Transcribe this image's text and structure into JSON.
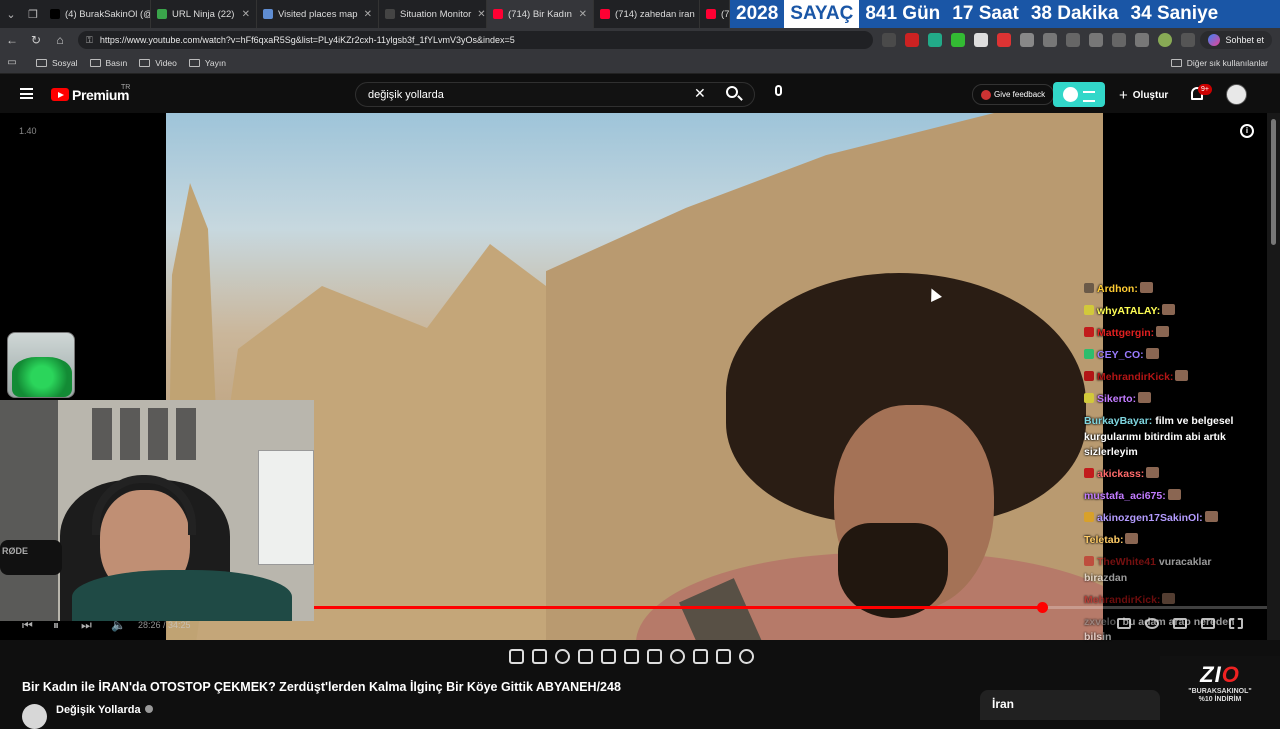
{
  "browser": {
    "tabs": [
      {
        "label": "(4) BurakSakinOl (@",
        "icon": "x-logo-icon",
        "color": "#000000",
        "active": false
      },
      {
        "label": "URL Ninja (22)",
        "icon": "ninja-icon",
        "color": "#3aa44b",
        "active": false
      },
      {
        "label": "Visited places map",
        "icon": "globe-icon",
        "color": "#5f8dd3",
        "active": false
      },
      {
        "label": "Situation Monitor",
        "icon": "monitor-icon",
        "color": "#444444",
        "active": false
      },
      {
        "label": "(714) Bir Kadın",
        "icon": "youtube-icon",
        "color": "#ff0033",
        "active": true
      },
      {
        "label": "(714) zahedan iran",
        "icon": "youtube-icon",
        "color": "#ff0033",
        "active": false
      },
      {
        "label": "(7",
        "icon": "youtube-icon",
        "color": "#ff0033",
        "active": false
      }
    ],
    "countdown": {
      "year": "2028",
      "label": "SAYAÇ",
      "days": "841 Gün",
      "hours": "17 Saat",
      "minutes": "38 Dakika",
      "seconds": "34 Saniye"
    },
    "url": "https://www.youtube.com/watch?v=hFf6qxaR5Sg&list=PLy4iKZr2cxh-11ylgsb3f_1fYLvmV3yOs&index=5",
    "chat_button": "Sohbet et",
    "bookmarks": [
      "Sosyal",
      "Basın",
      "Video",
      "Yayın"
    ],
    "other_bookmarks": "Diğer sık kullanılanlar"
  },
  "youtube": {
    "brand": "Premium",
    "region": "TR",
    "search_query": "değişik yollarda",
    "feedback_label": "Give feedback",
    "create_label": "Oluştur",
    "notification_count": "9+",
    "speed_overlay": "1.40"
  },
  "chat": [
    {
      "user": "Ardhon:",
      "text": "",
      "color": "#ffcc33",
      "badge": "#6b5a48"
    },
    {
      "user": "whyATALAY:",
      "text": "",
      "color": "#ffff55",
      "badge": "#d2c93a"
    },
    {
      "user": "Mattgergin:",
      "text": "",
      "color": "#e02020",
      "badge": "#c21c1c"
    },
    {
      "user": "CEY_CO:",
      "text": "",
      "color": "#9a7bff",
      "badge": "#2dbd6d"
    },
    {
      "user": "MehrandirKick:",
      "text": "",
      "color": "#b21515",
      "badge": "#b21515"
    },
    {
      "user": "Sikerto:",
      "text": "",
      "color": "#c27bff",
      "badge": "#d2c93a"
    },
    {
      "user": "BurkayBayar:",
      "text": "film ve belgesel kurgularımı bitirdim abi artık sizlerleyim",
      "color": "#7fd6e0",
      "badge": ""
    },
    {
      "user": "akickass:",
      "text": "",
      "color": "#ff6b6b",
      "badge": "#c21c1c"
    },
    {
      "user": "mustafa_aci675:",
      "text": "",
      "color": "#c27bff",
      "badge": ""
    },
    {
      "user": "akinozgen17SakinOl:",
      "text": "",
      "color": "#b49cff",
      "badge": "#d8a12a"
    },
    {
      "user": "Teletab:",
      "text": "",
      "color": "#ffcc66",
      "badge": ""
    },
    {
      "user": "TheWhite41",
      "text": "vuracaklar birazdan",
      "color": "#c21c1c",
      "badge": "#c21c1c"
    },
    {
      "user": "MehrandirKick:",
      "text": "",
      "color": "#b21515",
      "badge": ""
    },
    {
      "user": "zxvelo:",
      "text": "bu adam arap nereden bilsin",
      "color": "#8a8a8a",
      "badge": ""
    }
  ],
  "player": {
    "time": "28:26 / 34:25",
    "progress_fraction": 0.764,
    "webcam_label": "RØDE"
  },
  "video": {
    "title": "Bir Kadın ile İRAN'da OTOSTOP ÇEKMEK? Zerdüşt'lerden Kalma İlginç Bir Köye Gittik ABYANEH/248",
    "channel": "Değişik Yollarda"
  },
  "side_panel": {
    "label": "İran"
  },
  "promo": {
    "logo_main": "ZI",
    "logo_accent": "O",
    "line1": "\"BURAKSAKINOL\"",
    "line2": "%10 İNDİRİM"
  }
}
